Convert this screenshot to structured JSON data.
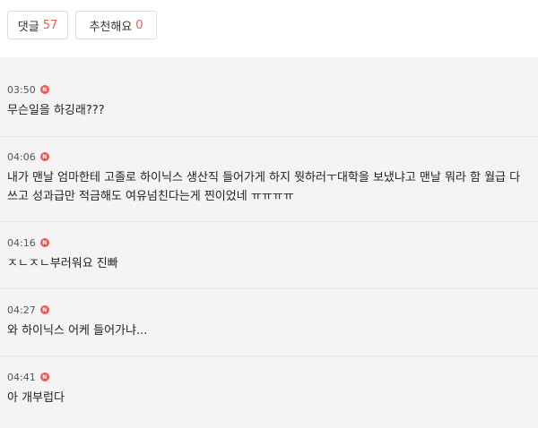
{
  "tabs": [
    {
      "label": "댓글",
      "count": "57"
    },
    {
      "label": "추천해요",
      "count": "0"
    }
  ],
  "badge_letter": "N",
  "comments": [
    {
      "time": "03:50",
      "text": "무슨일을 하깅래???"
    },
    {
      "time": "04:06",
      "text": "내가 맨날 엄마한테 고졸로 하이닉스 생산직 들어가게 하지 뭣하러ㅜ대학을 보냈냐고 맨날 뭐라 함 월급 다 쓰고 성과급만 적금해도 여유넘친다는게 찐이었네 ㅠㅠㅠㅠ"
    },
    {
      "time": "04:16",
      "text": "ㅈㄴㅈㄴ부러워요 진빠"
    },
    {
      "time": "04:27",
      "text": "와 하이닉스 어케 들어가냐..."
    },
    {
      "time": "04:41",
      "text": "아 개부럽다"
    }
  ],
  "colors": {
    "accent": "#ef5a5a",
    "badge": "#f05a50",
    "panel_bg": "#f4f4f4"
  }
}
